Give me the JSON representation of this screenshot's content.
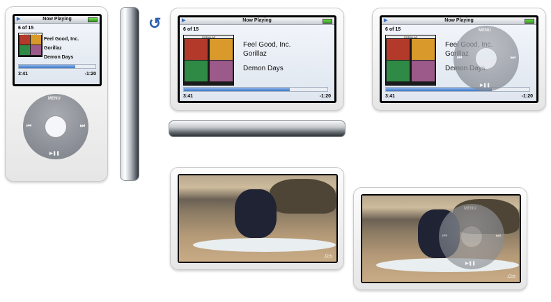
{
  "now_playing": {
    "title": "Now Playing",
    "count": "6 of 15",
    "song": "Feel Good, Inc.",
    "artist": "Gorillaz",
    "album": "Demon Days",
    "elapsed": "3:41",
    "remaining": "-1:20",
    "progress": 0.74,
    "album_art_label": "GORILLAZ"
  },
  "click_wheel": {
    "menu_label": "MENU",
    "prev_glyph": "⏮",
    "next_glyph": "⏭",
    "play_pause_glyph": "▶❚❚"
  },
  "rotate_icon": "↺",
  "video": {
    "watermark": "ℒcs"
  },
  "colors": {
    "accent_blue": "#3e77c8",
    "battery_green": "#4bbf2c",
    "wheel_gray": "#8a8d93",
    "rotate_blue": "#2a5fb0"
  }
}
